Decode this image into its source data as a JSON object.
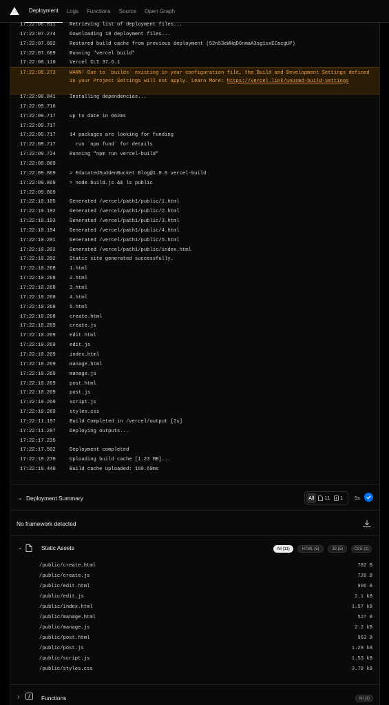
{
  "nav": {
    "tabs": [
      "Deployment",
      "Logs",
      "Functions",
      "Source",
      "Open Graph"
    ]
  },
  "log_before": [
    {
      "ts": "17:22:06.811",
      "msg": "Retrieving list of deployment files..."
    },
    {
      "ts": "17:22:07.274",
      "msg": "Downloading 18 deployment files..."
    },
    {
      "ts": "17:22:07.602",
      "msg": "Restored build cache from previous deployment (52n53eWHqD6nmaA3sg1sxECacgUP)"
    },
    {
      "ts": "17:22:07.689",
      "msg": "Running \"vercel build\""
    },
    {
      "ts": "17:22:08.110",
      "msg": "Vercel CLI 37.6.1"
    }
  ],
  "warning": {
    "ts": "17:22:08.273",
    "text": "WARN! Due to `builds` existing in your configuration file, the Build and Development Settings defined in your Project Settings will not apply. Learn More: ",
    "link": "https://vercel.link/unused-build-settings"
  },
  "log_after": [
    {
      "ts": "17:22:08.841",
      "msg": "Installing dependencies..."
    },
    {
      "ts": "17:22:09.716",
      "msg": ""
    },
    {
      "ts": "17:22:09.717",
      "msg": "up to date in 662ms"
    },
    {
      "ts": "17:22:09.717",
      "msg": ""
    },
    {
      "ts": "17:22:09.717",
      "msg": "14 packages are looking for funding"
    },
    {
      "ts": "17:22:09.717",
      "msg": "  run `npm fund` for details"
    },
    {
      "ts": "17:22:09.724",
      "msg": "Running \"npm run vercel-build\""
    },
    {
      "ts": "17:22:09.869",
      "msg": ""
    },
    {
      "ts": "17:22:09.869",
      "msg": "> EducatedSuddenBucket Blog@1.0.0 vercel-build"
    },
    {
      "ts": "17:22:09.869",
      "msg": "> node build.js && ls public"
    },
    {
      "ts": "17:22:09.869",
      "msg": ""
    },
    {
      "ts": "17:22:10.185",
      "msg": "Generated /vercel/path1/public/1.html"
    },
    {
      "ts": "17:22:10.192",
      "msg": "Generated /vercel/path1/public/2.html"
    },
    {
      "ts": "17:22:10.193",
      "msg": "Generated /vercel/path1/public/3.html"
    },
    {
      "ts": "17:22:10.194",
      "msg": "Generated /vercel/path1/public/4.html"
    },
    {
      "ts": "17:22:10.201",
      "msg": "Generated /vercel/path1/public/5.html"
    },
    {
      "ts": "17:22:10.202",
      "msg": "Generated /vercel/path1/public/index.html"
    },
    {
      "ts": "17:22:10.202",
      "msg": "Static site generated successfully."
    },
    {
      "ts": "17:22:10.268",
      "msg": "1.html"
    },
    {
      "ts": "17:22:10.268",
      "msg": "2.html"
    },
    {
      "ts": "17:22:10.268",
      "msg": "3.html"
    },
    {
      "ts": "17:22:10.268",
      "msg": "4.html"
    },
    {
      "ts": "17:22:10.268",
      "msg": "5.html"
    },
    {
      "ts": "17:22:10.268",
      "msg": "create.html"
    },
    {
      "ts": "17:22:10.269",
      "msg": "create.js"
    },
    {
      "ts": "17:22:10.269",
      "msg": "edit.html"
    },
    {
      "ts": "17:22:10.269",
      "msg": "edit.js"
    },
    {
      "ts": "17:22:10.269",
      "msg": "index.html"
    },
    {
      "ts": "17:22:10.269",
      "msg": "manage.html"
    },
    {
      "ts": "17:22:10.269",
      "msg": "manage.js"
    },
    {
      "ts": "17:22:10.269",
      "msg": "post.html"
    },
    {
      "ts": "17:22:10.269",
      "msg": "post.js"
    },
    {
      "ts": "17:22:10.269",
      "msg": "script.js"
    },
    {
      "ts": "17:22:10.269",
      "msg": "styles.css"
    },
    {
      "ts": "17:22:11.197",
      "msg": "Build Completed in /vercel/output [2s]"
    },
    {
      "ts": "17:22:11.287",
      "msg": "Deploying outputs..."
    },
    {
      "ts": "17:22:17.235",
      "msg": ""
    },
    {
      "ts": "17:22:17.502",
      "msg": "Deployment completed"
    },
    {
      "ts": "17:22:19.270",
      "msg": "Uploading build cache [1.23 MB]..."
    },
    {
      "ts": "17:22:19.440",
      "msg": "Build cache uploaded: 169.69ms"
    }
  ],
  "summary": {
    "title": "Deployment Summary",
    "filter_all": "All",
    "static_count": "11",
    "function_count": "1",
    "duration": "5s"
  },
  "framework": {
    "text": "No framework detected"
  },
  "static_assets": {
    "title": "Static Assets",
    "pills": [
      "All (11)",
      "HTML (5)",
      "JS (5)",
      "CSS (1)"
    ],
    "files": [
      {
        "path": "/public/create.html",
        "size": "782 B"
      },
      {
        "path": "/public/create.js",
        "size": "728 B"
      },
      {
        "path": "/public/edit.html",
        "size": "906 B"
      },
      {
        "path": "/public/edit.js",
        "size": "2.1 kB"
      },
      {
        "path": "/public/index.html",
        "size": "1.57 kB"
      },
      {
        "path": "/public/manage.html",
        "size": "527 B"
      },
      {
        "path": "/public/manage.js",
        "size": "2.2 kB"
      },
      {
        "path": "/public/post.html",
        "size": "963 B"
      },
      {
        "path": "/public/post.js",
        "size": "1.29 kB"
      },
      {
        "path": "/public/script.js",
        "size": "1.53 kB"
      },
      {
        "path": "/public/styles.css",
        "size": "3.78 kB"
      }
    ]
  },
  "functions": {
    "title": "Functions",
    "pill": "All (1)"
  },
  "colors": {
    "accent": "#0070f3",
    "warning_text": "#f1a24a",
    "warning_bg": "#2b1c06"
  }
}
